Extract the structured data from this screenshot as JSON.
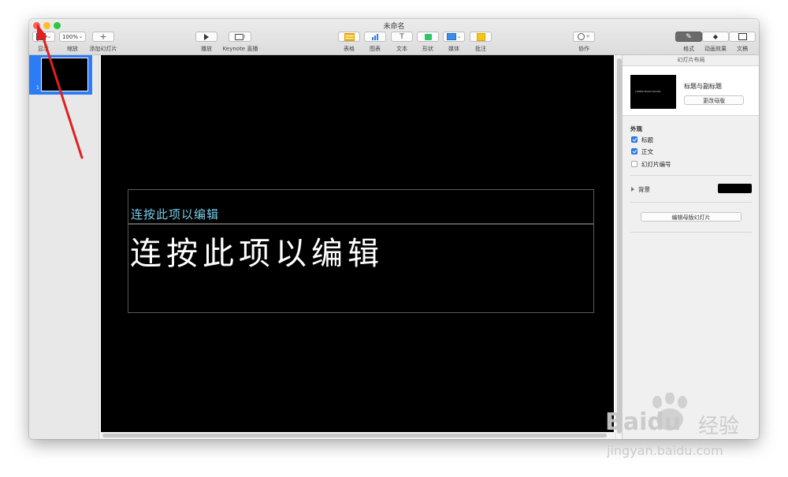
{
  "window": {
    "title": "未命名"
  },
  "toolbar": {
    "view_label": "显示",
    "zoom_value": "100%",
    "zoom_label": "缩放",
    "add_slide_label": "添加幻灯片",
    "play_label": "播放",
    "keynote_live_label": "Keynote 直播",
    "table_label": "表格",
    "chart_label": "图表",
    "text_label": "文本",
    "shape_label": "形状",
    "media_label": "媒体",
    "comment_label": "批注",
    "collaborate_label": "协作",
    "format_label": "格式",
    "animate_label": "动画效果",
    "document_label": "文稿"
  },
  "navigator": {
    "slide_number": "1"
  },
  "slide": {
    "subtitle_placeholder": "连按此项以编辑",
    "title_placeholder": "连按此项以编辑"
  },
  "inspector": {
    "header": "幻灯片布局",
    "layout_thumb_text": "LOREM IPSUM DOLOR",
    "layout_name": "标题与副标题",
    "change_master_button": "更改母版",
    "appearance_label": "外观",
    "checkboxes": [
      {
        "label": "标题",
        "checked": true
      },
      {
        "label": "正文",
        "checked": true
      },
      {
        "label": "幻灯片编号",
        "checked": false
      }
    ],
    "background_label": "背景",
    "background_color": "#000000",
    "edit_master_button": "编辑母版幻灯片"
  },
  "watermark": {
    "brand_text": "Baidu",
    "brand_cn": "经验",
    "url": "jingyan.baidu.com"
  },
  "colors": {
    "accent": "#2c7cf6",
    "annotation_arrow": "#e02020",
    "subtitle_text": "#79cdea"
  }
}
